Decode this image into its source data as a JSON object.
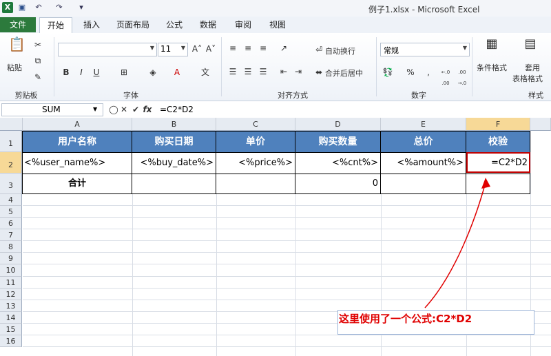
{
  "window": {
    "title": "例子1.xlsx - Microsoft Excel"
  },
  "quick_access": {
    "icons": [
      "excel-icon",
      "save-icon",
      "undo-icon",
      "redo-icon",
      "customize-icon"
    ]
  },
  "tabs": [
    {
      "label": "文件"
    },
    {
      "label": "开始"
    },
    {
      "label": "插入"
    },
    {
      "label": "页面布局"
    },
    {
      "label": "公式"
    },
    {
      "label": "数据"
    },
    {
      "label": "审阅"
    },
    {
      "label": "视图"
    }
  ],
  "ribbon": {
    "clipboard": {
      "paste_label": "粘贴",
      "group_label": "剪贴板"
    },
    "font": {
      "font_name": "",
      "font_size": "11",
      "group_label": "字体",
      "bold": "B",
      "italic": "I",
      "underline": "U"
    },
    "alignment": {
      "wrap_text": "自动换行",
      "merge_center": "合并后居中",
      "group_label": "对齐方式"
    },
    "number": {
      "format": "常规",
      "group_label": "数字",
      "percent": "%",
      "comma": ",",
      "inc_decimal": "←.0 .00",
      "dec_decimal": ".00 →.0"
    },
    "styles": {
      "conditional_format": "条件格式",
      "table_format_1": "套用",
      "table_format_2": "表格格式",
      "group_label": "样式"
    }
  },
  "formula_bar": {
    "name_box": "SUM",
    "fx_label": "fx",
    "formula": "=C2*D2"
  },
  "sheet": {
    "columns": [
      "A",
      "B",
      "C",
      "D",
      "E",
      "F"
    ],
    "rows": [
      "1",
      "2",
      "3",
      "4",
      "5",
      "6",
      "7",
      "8",
      "9",
      "10",
      "11",
      "12",
      "13",
      "14",
      "15",
      "16"
    ],
    "header_row": [
      "用户名称",
      "购买日期",
      "单价",
      "购买数量",
      "总价",
      "校验"
    ],
    "data_row": [
      "<%user_name%>",
      "<%buy_date%>",
      "<%price%>",
      "<%cnt%>",
      "<%amount%>",
      "=C2*D2"
    ],
    "total_row": {
      "label": "合计",
      "cnt_total": "0"
    }
  },
  "annotation": {
    "text": "这里使用了一个公式:C2*D2",
    "color": "#e00000"
  },
  "colors": {
    "header_fill": "#4f81bd",
    "file_tab": "#2c7a3c",
    "selection_border": "#c00000"
  }
}
